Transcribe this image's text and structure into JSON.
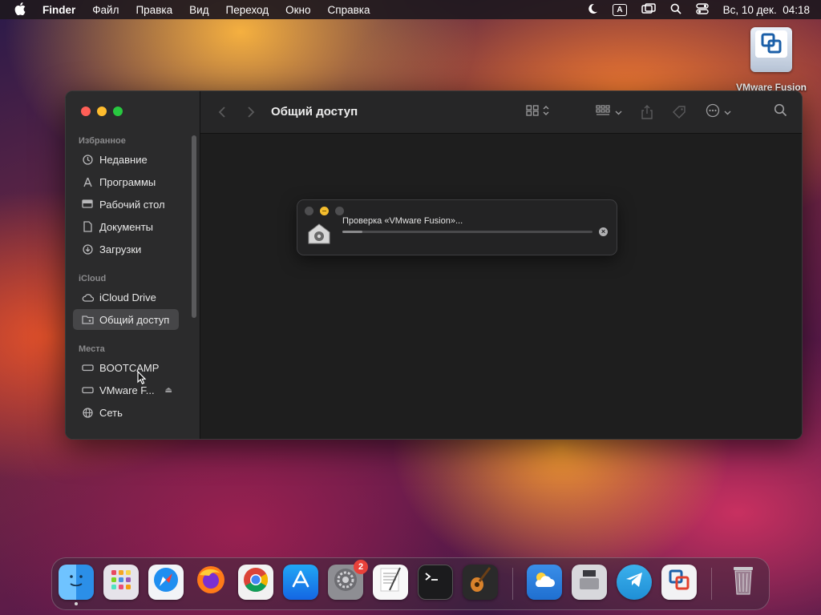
{
  "menubar": {
    "apple_icon": "apple-logo",
    "app_name": "Finder",
    "menus": [
      "Файл",
      "Правка",
      "Вид",
      "Переход",
      "Окно",
      "Справка"
    ],
    "input_source": "A",
    "datetime": "Вс, 10 дек.  04:18"
  },
  "desktop": {
    "icon_label": "VMware Fusion"
  },
  "finder": {
    "title": "Общий доступ",
    "sidebar": {
      "favorites_header": "Избранное",
      "favorites": [
        {
          "label": "Недавние",
          "icon": "clock-icon"
        },
        {
          "label": "Программы",
          "icon": "apps-icon"
        },
        {
          "label": "Рабочий стол",
          "icon": "desktop-icon"
        },
        {
          "label": "Документы",
          "icon": "document-icon"
        },
        {
          "label": "Загрузки",
          "icon": "download-icon"
        }
      ],
      "icloud_header": "iCloud",
      "icloud": [
        {
          "label": "iCloud Drive",
          "icon": "cloud-icon"
        },
        {
          "label": "Общий доступ",
          "icon": "shared-folder-icon",
          "selected": true
        }
      ],
      "places_header": "Места",
      "places": [
        {
          "label": "BOOTCAMP",
          "icon": "drive-icon"
        },
        {
          "label": "VMware F...",
          "icon": "drive-icon",
          "ejectable": true
        },
        {
          "label": "Сеть",
          "icon": "network-icon"
        }
      ]
    }
  },
  "progress": {
    "text": "Проверка «VMware Fusion»...",
    "fraction": 0.08
  },
  "dock": {
    "items": [
      {
        "name": "Finder",
        "running": true
      },
      {
        "name": "Launchpad"
      },
      {
        "name": "Safari"
      },
      {
        "name": "Firefox"
      },
      {
        "name": "Chrome"
      },
      {
        "name": "App Store"
      },
      {
        "name": "System Settings",
        "badge": "2"
      },
      {
        "name": "TextEdit"
      },
      {
        "name": "Terminal"
      },
      {
        "name": "GarageBand"
      },
      {
        "name": "Weather"
      },
      {
        "name": "Boot Camp Assistant"
      },
      {
        "name": "Telegram"
      },
      {
        "name": "VMware Fusion"
      },
      {
        "name": "Trash"
      }
    ]
  },
  "colors": {
    "close": "#ff5f57",
    "minimize": "#febc2e",
    "zoom": "#28c840",
    "badge": "#e8413a"
  }
}
